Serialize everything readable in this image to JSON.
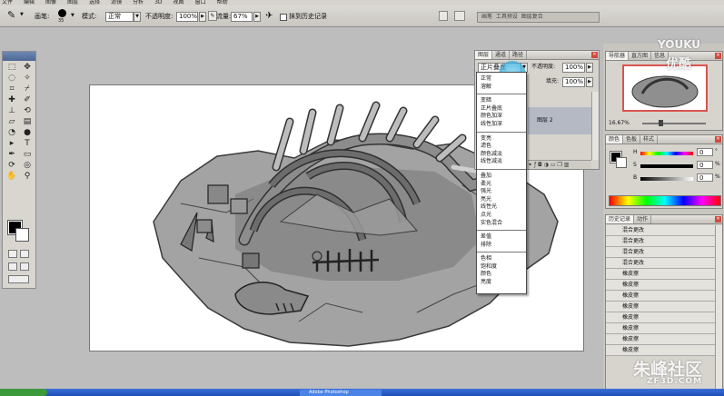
{
  "menu": [
    "文件",
    "编辑",
    "图像",
    "图层",
    "选择",
    "滤镜",
    "分析",
    "3D",
    "视图",
    "窗口",
    "帮助"
  ],
  "options": {
    "brush_label": "画笔:",
    "brush_size": "35",
    "mode_label": "模式:",
    "mode_value": "正常",
    "opacity_label": "不透明度:",
    "opacity_value": "100%",
    "flow_label": "流量:",
    "flow_value": "67%",
    "history_label": "抹到历史记录",
    "well_tabs": [
      "画笔",
      "工具预设",
      "图层复合"
    ]
  },
  "layers": {
    "tabs": [
      "图层",
      "通道",
      "路径"
    ],
    "blend_value": "正片叠底",
    "opacity_label": "不透明度:",
    "opacity_value": "100%",
    "fill_label": "填充:",
    "fill_value": "100%",
    "layer_name": "图层 2"
  },
  "blend_menu": [
    [
      "正常",
      "溶解"
    ],
    [
      "变暗",
      "正片叠底",
      "颜色加深",
      "线性加深"
    ],
    [
      "变亮",
      "滤色",
      "颜色减淡",
      "线性减淡"
    ],
    [
      "叠加",
      "柔光",
      "强光",
      "亮光",
      "线性光",
      "点光",
      "实色混合"
    ],
    [
      "差值",
      "排除"
    ],
    [
      "色相",
      "饱和度",
      "颜色",
      "亮度"
    ]
  ],
  "navigator": {
    "tabs": [
      "导航器",
      "直方图",
      "信息"
    ],
    "zoom": "16.67%"
  },
  "color": {
    "tabs": [
      "颜色",
      "色板",
      "样式"
    ],
    "channels": [
      {
        "label": "H",
        "value": "0",
        "unit": "°"
      },
      {
        "label": "S",
        "value": "0",
        "unit": "%"
      },
      {
        "label": "B",
        "value": "0",
        "unit": "%"
      }
    ]
  },
  "history": {
    "tabs": [
      "历史记录",
      "动作"
    ],
    "items": [
      "混合更改",
      "混合更改",
      "混合更改",
      "混合更改",
      "橡皮擦",
      "橡皮擦",
      "橡皮擦",
      "橡皮擦",
      "橡皮擦",
      "橡皮擦",
      "橡皮擦",
      "橡皮擦"
    ]
  },
  "taskbar": {
    "item": "Adobe Photoshop"
  },
  "watermarks": {
    "youku_en": "YOUKU",
    "youku_cn": "优酷",
    "site_cn": "朱峰社区",
    "site_en": "ZF3D.COM"
  }
}
